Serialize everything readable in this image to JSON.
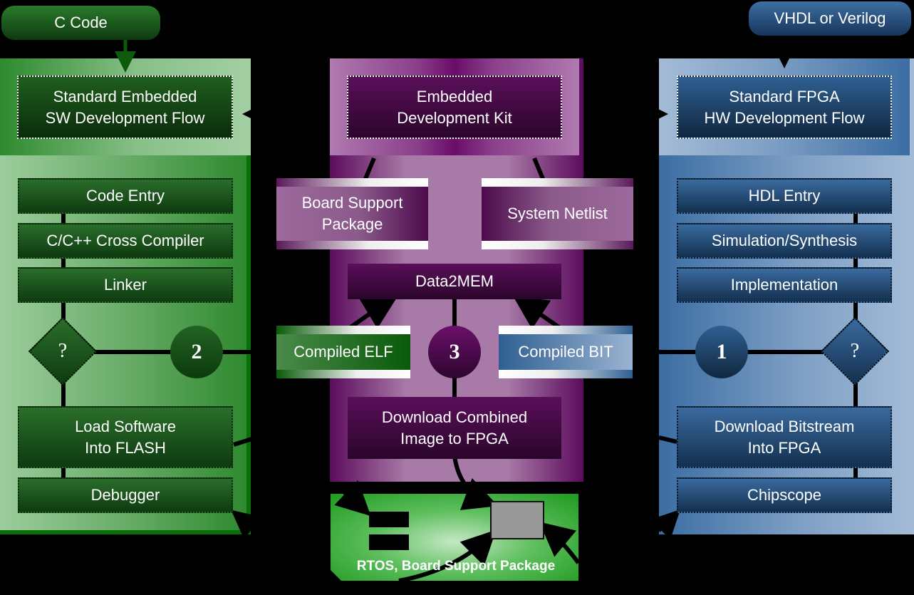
{
  "inputs": {
    "c_code": "C Code",
    "hdl": "VHDL or Verilog"
  },
  "sw_flow": {
    "header": "Standard Embedded\nSW Development Flow",
    "steps": [
      "Code Entry",
      "C/C++ Cross Compiler",
      "Linker"
    ],
    "decision": "?",
    "step_number": "2",
    "load": "Load Software\nInto FLASH",
    "debugger": "Debugger"
  },
  "edk": {
    "header": "Embedded\nDevelopment Kit",
    "bsp": "Board Support\nPackage",
    "netlist": "System Netlist",
    "data2mem": "Data2MEM",
    "elf": "Compiled ELF",
    "bit": "Compiled BIT",
    "step_number": "3",
    "download": "Download Combined\nImage to FPGA"
  },
  "hw_flow": {
    "header": "Standard FPGA\nHW Development Flow",
    "steps": [
      "HDL Entry",
      "Simulation/Synthesis",
      "Implementation"
    ],
    "decision": "?",
    "step_number": "1",
    "download": "Download Bitstream\nInto FPGA",
    "chipscope": "Chipscope"
  },
  "board": {
    "label": "RTOS, Board Support Package"
  },
  "colors": {
    "sw_green": "#1f5e1f",
    "edk_purple": "#5a0f5a",
    "hw_blue": "#2f5f92",
    "board_green": "#1e9a1e"
  }
}
